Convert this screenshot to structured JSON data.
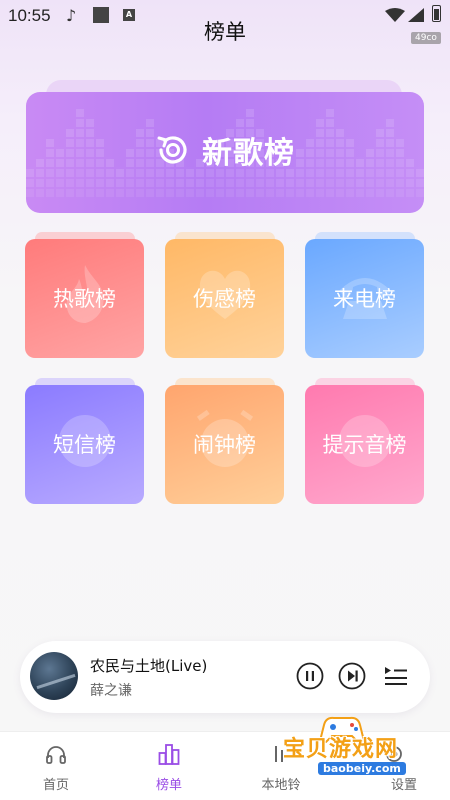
{
  "status_bar": {
    "time": "10:55",
    "badge": "49co"
  },
  "header": {
    "title": "榜单"
  },
  "banner": {
    "label": "新歌榜",
    "icon": "new-release-icon"
  },
  "tiles": [
    {
      "label": "热歌榜",
      "icon": "flame-icon",
      "colors": [
        "#ff7b7b",
        "#ffa4a4"
      ]
    },
    {
      "label": "伤感榜",
      "icon": "heart-icon",
      "colors": [
        "#ffb866",
        "#ffd29a"
      ]
    },
    {
      "label": "来电榜",
      "icon": "phone-icon",
      "colors": [
        "#6aa8ff",
        "#a9cdff"
      ]
    },
    {
      "label": "短信榜",
      "icon": "message-icon",
      "colors": [
        "#8b7bff",
        "#b8aaff"
      ]
    },
    {
      "label": "闹钟榜",
      "icon": "alarm-clock-icon",
      "colors": [
        "#ffa56e",
        "#ffcf99"
      ]
    },
    {
      "label": "提示音榜",
      "icon": "bell-icon",
      "colors": [
        "#ff7aaf",
        "#ffa8cd"
      ]
    }
  ],
  "player": {
    "title": "农民与土地(Live)",
    "artist": "薛之谦",
    "controls": [
      "pause-icon",
      "next-icon",
      "playlist-icon"
    ]
  },
  "nav": [
    {
      "label": "首页",
      "icon": "headphones-icon",
      "active": false
    },
    {
      "label": "榜单",
      "icon": "chart-bars-icon",
      "active": true
    },
    {
      "label": "本地铃",
      "icon": "local-ringtone-icon",
      "active": false
    },
    {
      "label": "设置",
      "icon": "settings-icon",
      "active": false
    }
  ],
  "watermark": {
    "text": "宝贝游戏网",
    "url": "baobeiy.com"
  },
  "colors": {
    "accent": "#9a4de6",
    "banner": "#b57cf4"
  }
}
